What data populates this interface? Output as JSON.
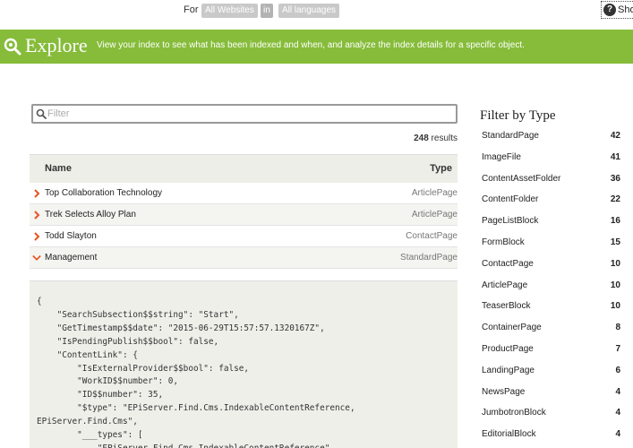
{
  "topbar": {
    "for_label": "For",
    "sites_label": "All Websites",
    "in_label": "in",
    "languages_label": "All languages",
    "show_label": "Sho"
  },
  "banner": {
    "title": "Explore",
    "description": "View your index to see what has been indexed and when, and analyze the index details for a specific object."
  },
  "search": {
    "placeholder": "Filter"
  },
  "results": {
    "count": "248",
    "label": "results"
  },
  "table": {
    "headers": {
      "name": "Name",
      "type": "Type"
    },
    "rows": [
      {
        "name": "Top Collaboration Technology",
        "type": "ArticlePage",
        "expanded": false
      },
      {
        "name": "Trek Selects Alloy Plan",
        "type": "ArticlePage",
        "expanded": false
      },
      {
        "name": "Todd Slayton",
        "type": "ContactPage",
        "expanded": false
      },
      {
        "name": "Management",
        "type": "StandardPage",
        "expanded": true
      }
    ]
  },
  "json_detail": "{\n    \"SearchSubsection$$string\": \"Start\",\n    \"GetTimestamp$$date\": \"2015-06-29T15:57:57.1320167Z\",\n    \"IsPendingPublish$$bool\": false,\n    \"ContentLink\": {\n        \"IsExternalProvider$$bool\": false,\n        \"WorkID$$number\": 0,\n        \"ID$$number\": 35,\n        \"$type\": \"EPiServer.Find.Cms.IndexableContentReference, EPiServer.Find.Cms\",\n        \"___types\": [\n            \"EPiServer.Find.Cms.IndexableContentReference\",",
  "sidebar": {
    "title": "Filter by Type",
    "items": [
      {
        "label": "StandardPage",
        "count": "42"
      },
      {
        "label": "ImageFile",
        "count": "41"
      },
      {
        "label": "ContentAssetFolder",
        "count": "36"
      },
      {
        "label": "ContentFolder",
        "count": "22"
      },
      {
        "label": "PageListBlock",
        "count": "16"
      },
      {
        "label": "FormBlock",
        "count": "15"
      },
      {
        "label": "ContactPage",
        "count": "10"
      },
      {
        "label": "ArticlePage",
        "count": "10"
      },
      {
        "label": "TeaserBlock",
        "count": "10"
      },
      {
        "label": "ContainerPage",
        "count": "8"
      },
      {
        "label": "ProductPage",
        "count": "7"
      },
      {
        "label": "LandingPage",
        "count": "6"
      },
      {
        "label": "NewsPage",
        "count": "4"
      },
      {
        "label": "JumbotronBlock",
        "count": "4"
      },
      {
        "label": "EditorialBlock",
        "count": "4"
      }
    ]
  },
  "colors": {
    "banner_green": "#86bc3a",
    "chevron_orange": "#e8531f"
  },
  "icons": {
    "banner": "explore-magnifier-icon",
    "filter": "search-icon",
    "row_collapsed": "chevron-right-icon",
    "row_expanded": "chevron-down-icon",
    "help": "question-icon"
  }
}
